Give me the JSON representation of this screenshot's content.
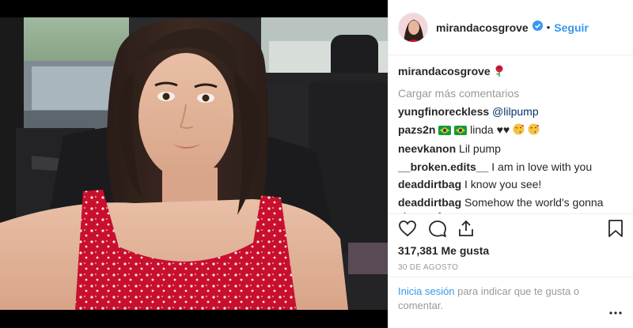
{
  "header": {
    "username": "mirandacosgrove",
    "separator": "•",
    "follow_label": "Seguir"
  },
  "caption": {
    "username": "mirandacosgrove",
    "emoji": "rose"
  },
  "load_more_label": "Cargar más comentarios",
  "comments": [
    {
      "user": "yungfinoreckless",
      "text": "@lilpump"
    },
    {
      "user": "pazs2n",
      "text": "linda ♥♥"
    },
    {
      "user": "neevkanon",
      "text": "Lil pump"
    },
    {
      "user": "__broken.edits__",
      "text": "I am in love with you"
    },
    {
      "user": "deaddirtbag",
      "text": "I know you see!"
    },
    {
      "user": "deaddirtbag",
      "text": "Somehow the world's gonna change for me"
    }
  ],
  "likes_text": "317,381 Me gusta",
  "date_text": "30 DE AGOSTO",
  "login": {
    "link": "Inicia sesión",
    "rest": "para indicar que te gusta o comentar."
  },
  "icons": {
    "like": "heart-icon",
    "comment": "comment-icon",
    "share": "share-icon",
    "save": "bookmark-icon",
    "more": "more-options-icon"
  },
  "colors": {
    "link_blue": "#3897f0",
    "text": "#262626",
    "muted": "#999999",
    "dress_red": "#c8102e"
  }
}
